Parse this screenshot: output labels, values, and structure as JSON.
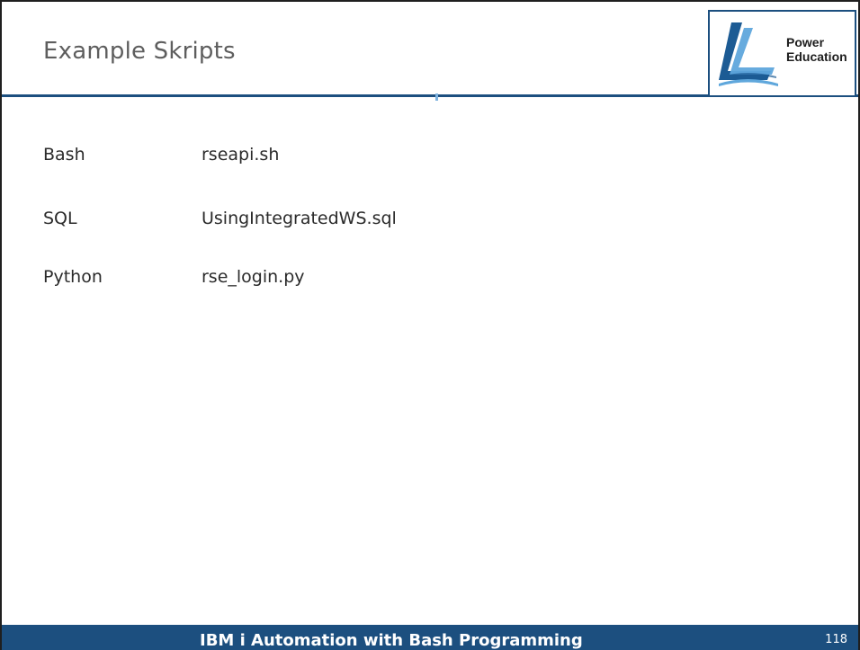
{
  "header": {
    "title": "Example Skripts",
    "logo": {
      "line1": "Power",
      "line2": "Education",
      "colors": {
        "dark": "#1c5b94",
        "light": "#5fa7dc"
      }
    }
  },
  "scripts": [
    {
      "language": "Bash",
      "file": "rseapi.sh"
    },
    {
      "language": "SQL",
      "file": "UsingIntegratedWS.sql"
    },
    {
      "language": "Python",
      "file": "rse_login.py"
    }
  ],
  "footer": {
    "title": "IBM i Automation with Bash Programming",
    "page_number": "118"
  },
  "colors": {
    "accent": "#1c4f7f",
    "title_text": "#5e5e5e",
    "body_text": "#2b2b2b"
  }
}
